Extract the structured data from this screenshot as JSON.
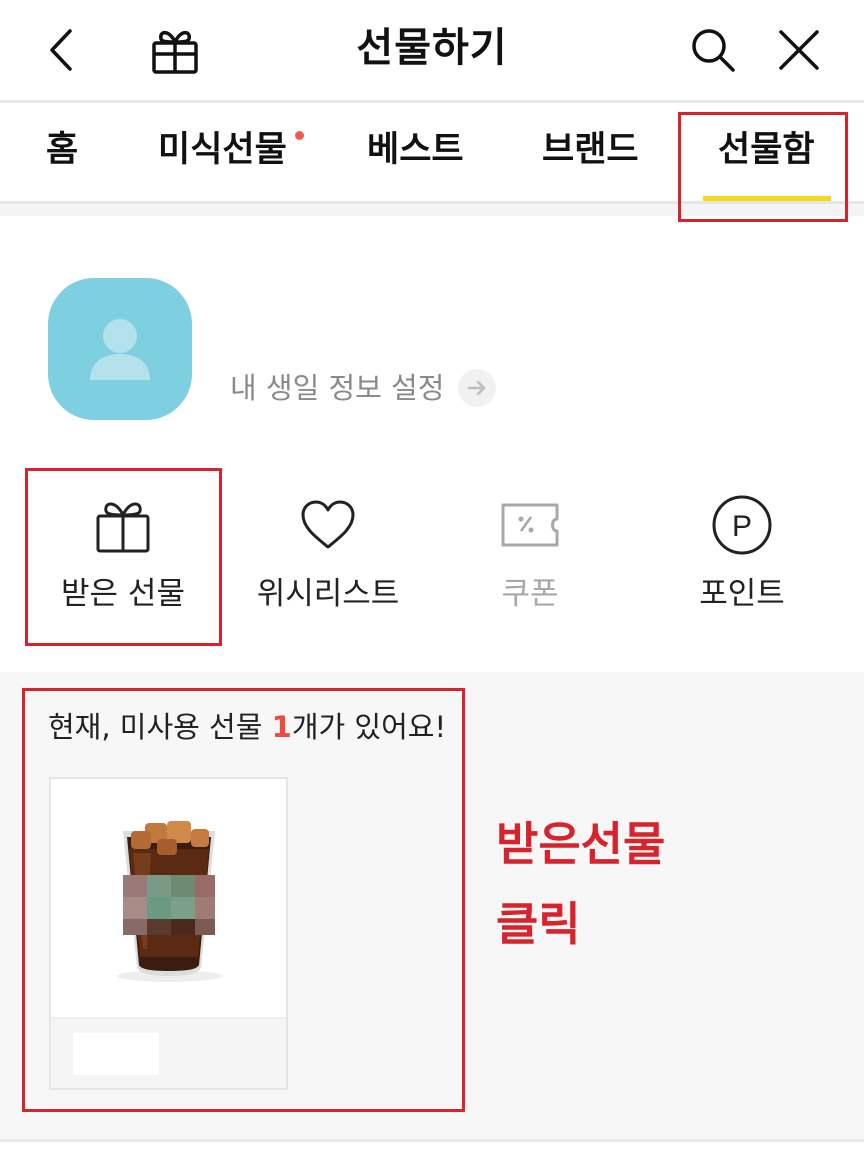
{
  "header": {
    "title": "선물하기",
    "back_icon": "chevron-left-icon",
    "gift_icon": "gift-icon",
    "search_icon": "search-icon",
    "close_icon": "close-icon"
  },
  "tabs": [
    {
      "label": "홈"
    },
    {
      "label": "미식선물",
      "badge": "new-dot"
    },
    {
      "label": "베스트"
    },
    {
      "label": "브랜드"
    },
    {
      "label": "선물함",
      "selected": true
    }
  ],
  "profile": {
    "birthday_link": "내 생일 정보 설정",
    "avatar_color": "#7ecfe0"
  },
  "menu": [
    {
      "label": "받은 선물",
      "icon": "gift-icon"
    },
    {
      "label": "위시리스트",
      "icon": "heart-icon"
    },
    {
      "label": "쿠폰",
      "icon": "coupon-icon"
    },
    {
      "label": "포인트",
      "icon": "point-icon"
    }
  ],
  "gift_section": {
    "heading_prefix": "현재, 미사용 선물 ",
    "unused_count": "1",
    "heading_suffix": "개가 있어요!",
    "item_image": "iced-coffee-cup"
  },
  "annotations": {
    "line1": "받은선물",
    "line2": "클릭",
    "color": "#d8222c"
  },
  "colors": {
    "tab_underline": "#f7d917",
    "count_highlight": "#ef4b3c",
    "badge_dot": "#f15b4c"
  }
}
